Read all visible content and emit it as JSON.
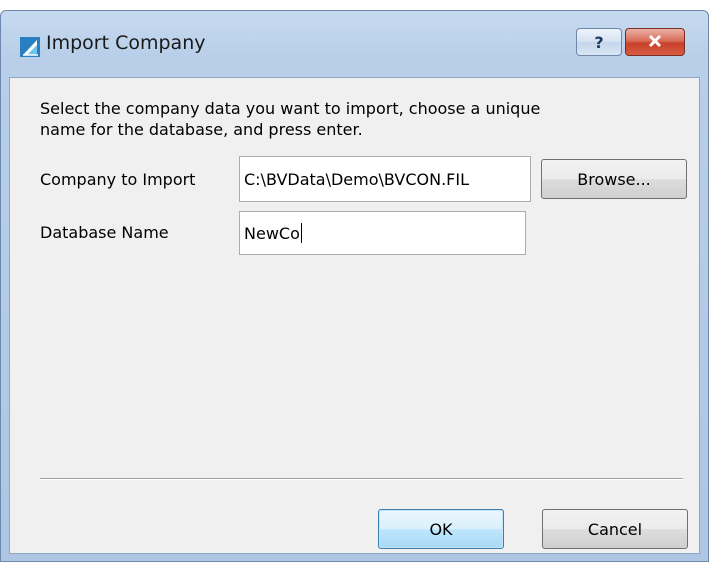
{
  "window": {
    "title": "Import Company"
  },
  "titlebar": {
    "help_label": "?",
    "close_icon": "close-x-icon",
    "app_icon": "sail-logo-icon",
    "accent_color": "#2a7fc0",
    "close_color": "#c8402a"
  },
  "dialog": {
    "intro_line1": "Select the company data you want to import, choose a unique",
    "intro_line2": "name for the database, and press enter.",
    "company_label": "Company to Import",
    "company_value": "C:\\BVData\\Demo\\BVCON.FIL",
    "browse_label": "Browse...",
    "database_label": "Database Name",
    "database_value": "NewCo",
    "ok_label": "OK",
    "cancel_label": "Cancel"
  }
}
